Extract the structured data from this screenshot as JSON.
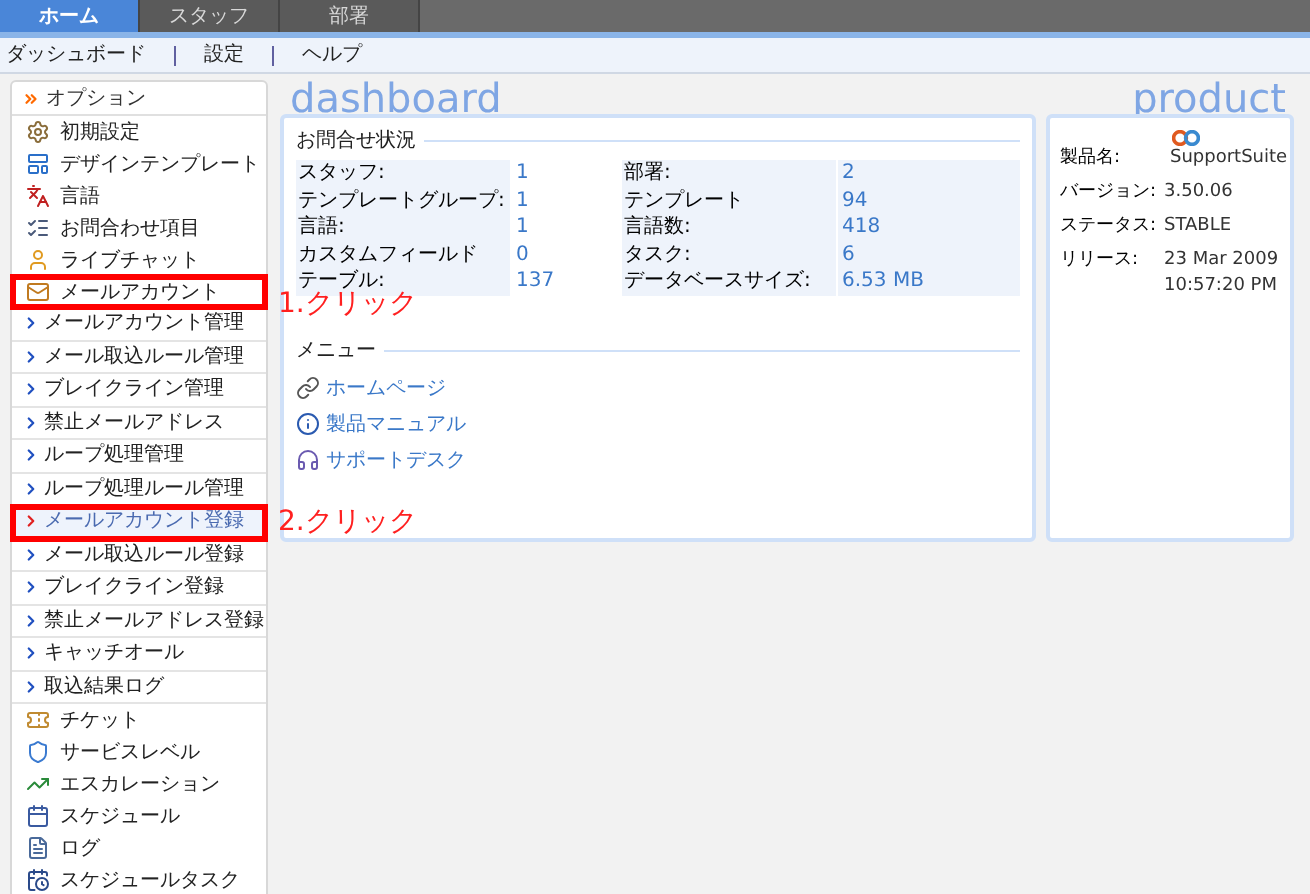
{
  "tabs": [
    {
      "label": "ホーム",
      "selected": true
    },
    {
      "label": "スタッフ",
      "selected": false
    },
    {
      "label": "部署",
      "selected": false
    }
  ],
  "subnav": [
    "ダッシュボード",
    "設定",
    "ヘルプ"
  ],
  "sidebar": {
    "title": "オプション",
    "items": [
      {
        "kind": "icon",
        "label": "初期設定",
        "selected": false,
        "highlighted": false
      },
      {
        "kind": "icon",
        "label": "デザインテンプレート",
        "selected": false,
        "highlighted": false
      },
      {
        "kind": "icon",
        "label": "言語",
        "selected": false,
        "highlighted": false
      },
      {
        "kind": "icon",
        "label": "お問合わせ項目",
        "selected": false,
        "highlighted": false
      },
      {
        "kind": "icon",
        "label": "ライブチャット",
        "selected": false,
        "highlighted": false
      },
      {
        "kind": "icon",
        "label": "メールアカウント",
        "selected": false,
        "highlighted": true
      },
      {
        "kind": "sub",
        "label": "メールアカウント管理",
        "selected": false,
        "highlighted": false
      },
      {
        "kind": "sub",
        "label": "メール取込ルール管理",
        "selected": false,
        "highlighted": false
      },
      {
        "kind": "sub",
        "label": "ブレイクライン管理",
        "selected": false,
        "highlighted": false
      },
      {
        "kind": "sub",
        "label": "禁止メールアドレス",
        "selected": false,
        "highlighted": false
      },
      {
        "kind": "sub",
        "label": "ループ処理管理",
        "selected": false,
        "highlighted": false
      },
      {
        "kind": "sub",
        "label": "ループ処理ルール管理",
        "selected": false,
        "highlighted": false
      },
      {
        "kind": "sub",
        "label": "メールアカウント登録",
        "selected": true,
        "highlighted": true
      },
      {
        "kind": "sub",
        "label": "メール取込ルール登録",
        "selected": false,
        "highlighted": false
      },
      {
        "kind": "sub",
        "label": "ブレイクライン登録",
        "selected": false,
        "highlighted": false
      },
      {
        "kind": "sub",
        "label": "禁止メールアドレス登録",
        "selected": false,
        "highlighted": false
      },
      {
        "kind": "sub",
        "label": "キャッチオール",
        "selected": false,
        "highlighted": false
      },
      {
        "kind": "sub",
        "label": "取込結果ログ",
        "selected": false,
        "highlighted": false
      },
      {
        "kind": "icon",
        "label": "チケット",
        "selected": false,
        "highlighted": false
      },
      {
        "kind": "icon",
        "label": "サービスレベル",
        "selected": false,
        "highlighted": false
      },
      {
        "kind": "icon",
        "label": "エスカレーション",
        "selected": false,
        "highlighted": false
      },
      {
        "kind": "icon",
        "label": "スケジュール",
        "selected": false,
        "highlighted": false
      },
      {
        "kind": "icon",
        "label": "ログ",
        "selected": false,
        "highlighted": false
      },
      {
        "kind": "icon",
        "label": "スケジュールタスク",
        "selected": false,
        "highlighted": false
      }
    ]
  },
  "dashboard": {
    "heading": "dashboard",
    "status_title": "お問合せ状況",
    "rows": [
      {
        "label_1": "スタッフ:",
        "value_1": "1",
        "label_2": "部署:",
        "value_2": "2"
      },
      {
        "label_1": "テンプレートグループ:",
        "value_1": "1",
        "label_2": "テンプレート",
        "value_2": "94"
      },
      {
        "label_1": "言語:",
        "value_1": "1",
        "label_2": "言語数:",
        "value_2": "418"
      },
      {
        "label_1": "カスタムフィールド",
        "value_1": "0",
        "label_2": "タスク:",
        "value_2": "6"
      },
      {
        "label_1": "テーブル:",
        "value_1": "137",
        "label_2": "データベースサイズ:",
        "value_2": "6.53 MB"
      }
    ],
    "menu_title": "メニュー",
    "links": [
      {
        "label": "ホームページ"
      },
      {
        "label": "製品マニュアル"
      },
      {
        "label": "サポートデスク"
      }
    ]
  },
  "product": {
    "heading": "product",
    "fields": [
      {
        "kind": "logo",
        "label": "製品名:",
        "value": "SupportSuite"
      },
      {
        "kind": "plain",
        "label": "バージョン:",
        "value": "3.50.06"
      },
      {
        "kind": "plain",
        "label": "ステータス:",
        "value": "STABLE"
      },
      {
        "kind": "plain",
        "label": "リリース:",
        "value": "23 Mar 2009 10:57:20 PM"
      }
    ]
  },
  "annotations": [
    "1.クリック",
    "2.クリック"
  ]
}
